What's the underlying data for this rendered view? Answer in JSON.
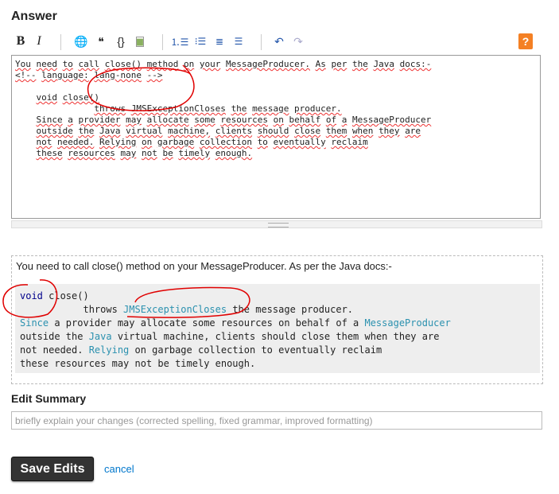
{
  "title": "Answer",
  "toolbar": [
    {
      "name": "bold-button",
      "label": "B",
      "icon": "bold-icon"
    },
    {
      "name": "italic-button",
      "label": "I",
      "icon": "italic-icon"
    },
    {
      "name": "link-button",
      "label": "🌐",
      "icon": "globe-link-icon"
    },
    {
      "name": "blockquote-button",
      "label": "❝",
      "icon": "quote-icon"
    },
    {
      "name": "code-button",
      "label": "{}",
      "icon": "code-braces-icon"
    },
    {
      "name": "image-button",
      "label": "▆",
      "icon": "image-icon"
    },
    {
      "name": "numbered-list-button",
      "label": "⒈☰",
      "icon": "numbered-list-icon"
    },
    {
      "name": "bulleted-list-button",
      "label": "⁝☰",
      "icon": "bulleted-list-icon"
    },
    {
      "name": "heading-button",
      "label": "≣",
      "icon": "heading-icon"
    },
    {
      "name": "horizontal-rule-button",
      "label": "☰",
      "icon": "horizontal-rule-icon"
    },
    {
      "name": "undo-button",
      "label": "↶",
      "icon": "undo-icon"
    },
    {
      "name": "redo-button",
      "label": "↷",
      "icon": "redo-icon"
    },
    {
      "name": "help-button",
      "label": "?",
      "icon": "help-icon"
    }
  ],
  "editor": {
    "lines": [
      "You need to call close() method on your MessageProducer. As per the Java docs:-",
      "<!-- language: lang-none -->",
      "",
      "    void close()",
      "               throws JMSExceptionCloses the message producer.",
      "    Since a provider may allocate some resources on behalf of a MessageProducer",
      "    outside the Java virtual machine, clients should close them when they are",
      "    not needed. Relying on garbage collection to eventually reclaim",
      "    these resources may not be timely enough."
    ]
  },
  "preview": {
    "text": "You need to call close() method on your MessageProducer. As per the Java docs:-",
    "code": [
      [
        [
          "void",
          "kw"
        ],
        [
          " close()",
          ""
        ]
      ],
      [
        [
          "           throws ",
          ""
        ],
        [
          "JMSExceptionCloses",
          "typ"
        ],
        [
          " the message producer.",
          ""
        ]
      ],
      [
        [
          "Since",
          "typ"
        ],
        [
          " a provider may allocate some resources on behalf of a ",
          ""
        ],
        [
          "MessageProducer",
          "typ"
        ]
      ],
      [
        [
          "outside the ",
          ""
        ],
        [
          "Java",
          "typ"
        ],
        [
          " virtual machine, clients should close them when they are",
          ""
        ]
      ],
      [
        [
          "not needed. ",
          ""
        ],
        [
          "Relying",
          "typ"
        ],
        [
          " on garbage collection to eventually reclaim",
          ""
        ]
      ],
      [
        [
          "these resources may not be timely enough.",
          ""
        ]
      ]
    ]
  },
  "summary": {
    "label": "Edit Summary",
    "placeholder": "briefly explain your changes (corrected spelling, fixed grammar, improved formatting)"
  },
  "actions": {
    "save": "Save Edits",
    "cancel": "cancel"
  },
  "colors": {
    "accent": "#f48024",
    "annotation": "#e00000",
    "link": "#0077cc",
    "code_type": "#2b91af"
  }
}
